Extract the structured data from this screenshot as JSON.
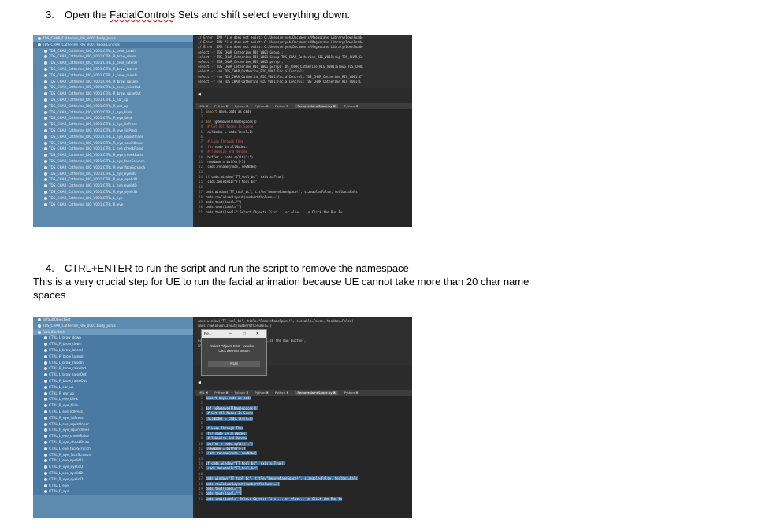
{
  "step3": {
    "number": "3.",
    "text_before": "Open the ",
    "text_squiggle": "FacialControls",
    "text_after": " Sets and shift select everything down."
  },
  "step4": {
    "number": "4.",
    "text": "CTRL+ENTER to run the script and run the script to remove the namespace",
    "note": "This is a very crucial step for UE to run the facial animation because UE cannot take more than 20 char name spaces"
  },
  "shot1": {
    "outliner_rows": [
      {
        "label": "TDS_CHAR_Catherine_RIG_V001:Body_joints",
        "type": "hdr"
      },
      {
        "label": "TDS_CHAR_Catherine_RIG_V001:FacialControls",
        "type": "sel"
      },
      {
        "label": "TDS_CHAR_Catherine_RIG_V001:CTRL_L_brow_down",
        "type": "row"
      },
      {
        "label": "TDS_CHAR_Catherine_RIG_V001:CTRL_R_brow_down",
        "type": "row"
      },
      {
        "label": "TDS_CHAR_Catherine_RIG_V001:CTRL_L_brow_lateral",
        "type": "row"
      },
      {
        "label": "TDS_CHAR_Catherine_RIG_V001:CTRL_R_brow_lateral",
        "type": "row"
      },
      {
        "label": "TDS_CHAR_Catherine_RIG_V001:CTRL_L_brow_raiseIn",
        "type": "row"
      },
      {
        "label": "TDS_CHAR_Catherine_RIG_V001:CTRL_R_brow_raiseIn",
        "type": "row"
      },
      {
        "label": "TDS_CHAR_Catherine_RIG_V001:CTRL_L_brow_raiseOut",
        "type": "row"
      },
      {
        "label": "TDS_CHAR_Catherine_RIG_V001:CTRL_R_brow_raiseOut",
        "type": "row"
      },
      {
        "label": "TDS_CHAR_Catherine_RIG_V001:CTRL_L_ear_up",
        "type": "row"
      },
      {
        "label": "TDS_CHAR_Catherine_RIG_V001:CTRL_R_ear_up",
        "type": "row"
      },
      {
        "label": "TDS_CHAR_Catherine_RIG_V001:CTRL_L_eye_blink",
        "type": "row"
      },
      {
        "label": "TDS_CHAR_Catherine_RIG_V001:CTRL_R_eye_blink",
        "type": "row"
      },
      {
        "label": "TDS_CHAR_Catherine_RIG_V001:CTRL_L_eye_lidPress",
        "type": "row"
      },
      {
        "label": "TDS_CHAR_Catherine_RIG_V001:CTRL_R_eye_lidPress",
        "type": "row"
      },
      {
        "label": "TDS_CHAR_Catherine_RIG_V001:CTRL_L_eye_squintInner",
        "type": "row"
      },
      {
        "label": "TDS_CHAR_Catherine_RIG_V001:CTRL_R_eye_squintInner",
        "type": "row"
      },
      {
        "label": "TDS_CHAR_Catherine_RIG_V001:CTRL_L_eye_cheekRaise",
        "type": "row"
      },
      {
        "label": "TDS_CHAR_Catherine_RIG_V001:CTRL_R_eye_cheekRaise",
        "type": "row"
      },
      {
        "label": "TDS_CHAR_Catherine_RIG_V001:CTRL_L_eye_faceScrunch",
        "type": "row"
      },
      {
        "label": "TDS_CHAR_Catherine_RIG_V001:CTRL_R_eye_faceScrunch",
        "type": "row"
      },
      {
        "label": "TDS_CHAR_Catherine_RIG_V001:CTRL_L_eye_eyelidU",
        "type": "row"
      },
      {
        "label": "TDS_CHAR_Catherine_RIG_V001:CTRL_R_eye_eyelidU",
        "type": "row"
      },
      {
        "label": "TDS_CHAR_Catherine_RIG_V001:CTRL_L_eye_eyelidD",
        "type": "row"
      },
      {
        "label": "TDS_CHAR_Catherine_RIG_V001:CTRL_R_eye_eyelidD",
        "type": "row"
      },
      {
        "label": "TDS_CHAR_Catherine_RIG_V001:CTRL_L_eye",
        "type": "row"
      },
      {
        "label": "TDS_CHAR_Catherine_RIG_V001:CTRL_R_eye",
        "type": "row"
      }
    ],
    "console_lines": [
      "// Error: IMA file does not exist: C:/Users/ntyoh/Documents/Megascans Library/Downloade",
      "// Error: IMA file does not exist: C:/Users/ntyoh/Documents/Megascans Library/Downloade",
      "// Error: IMA file does not exist: C:/Users/ntyoh/Documents/Megascans Library/Downloade",
      "select -r TDS_CHAR_Catherine_RIG_V001:Group ;",
      "select -r TDS_CHAR_Catherine_RIG_V001:Group TDS_CHAR_Catherine_RIG_V001:rig TDS_CHAR_Ca",
      "select -r TDS_CHAR_Catherine_RIG_V001:persp ;",
      "select -r TDS_CHAR_Catherine_RIG_V001:persp1 TDS_CHAR_Catherine_RIG_V001:Group TDS_CHAR",
      "select -r -ne TDS_CHAR_Catherine_RIG_V001:FacialControls ;",
      "select -r -ne TDS_CHAR_Catherine_RIG_V001:FacialControls TDS_CHAR_Catherine_RIG_V001:CT",
      "select -r -ne TDS_CHAR_Catherine_RIG_V001:FacialControls TDS_CHAR_Catherine_RIG_V001:CT"
    ],
    "tabs": [
      "MEL",
      "Python",
      "Python",
      "Python",
      "Python",
      "RemoveNameSpace.py",
      "Python"
    ],
    "code": [
      {
        "n": "1",
        "parts": [
          {
            "c": "kw",
            "t": "import"
          },
          {
            "c": "tx",
            "t": " maya.cmds as cmds"
          }
        ]
      },
      {
        "n": "2",
        "parts": []
      },
      {
        "n": "3",
        "parts": [
          {
            "c": "kw",
            "t": "def"
          },
          {
            "c": "tx",
            "t": " jgRemoveAllNamespaces():"
          }
        ]
      },
      {
        "n": "4",
        "parts": [
          {
            "c": "cm",
            "t": "    # Get All Nodes In Scene"
          }
        ]
      },
      {
        "n": "5",
        "parts": [
          {
            "c": "tx",
            "t": "    allNodes = cmds.ls(sl=1)"
          }
        ]
      },
      {
        "n": "6",
        "parts": []
      },
      {
        "n": "7",
        "parts": [
          {
            "c": "cm",
            "t": "    # Loop Through Them"
          }
        ]
      },
      {
        "n": "8",
        "parts": [
          {
            "c": "kw",
            "t": "    for"
          },
          {
            "c": "tx",
            "t": " node in allNodes:"
          }
        ]
      },
      {
        "n": "9",
        "parts": [
          {
            "c": "cm",
            "t": "        # Tokenize And Rename"
          }
        ]
      },
      {
        "n": "10",
        "parts": [
          {
            "c": "tx",
            "t": "        buffer = node.split(\":\")"
          }
        ]
      },
      {
        "n": "11",
        "parts": [
          {
            "c": "tx",
            "t": "        newName = buffer[-1]"
          }
        ]
      },
      {
        "n": "12",
        "parts": [
          {
            "c": "tx",
            "t": "        cmds.rename(node, newName)"
          }
        ]
      },
      {
        "n": "13",
        "parts": []
      },
      {
        "n": "14",
        "parts": [
          {
            "c": "kw",
            "t": "if"
          },
          {
            "c": "tx",
            "t": " cmds.window(\"TT_tool_bc\", exists=True):"
          }
        ]
      },
      {
        "n": "15",
        "parts": [
          {
            "c": "tx",
            "t": "    cmds.deleteUI(\"TT_tool_bc\")"
          }
        ]
      },
      {
        "n": "16",
        "parts": []
      },
      {
        "n": "17",
        "parts": [
          {
            "c": "tx",
            "t": "cmds.window(\"TT_tool_bc\", title=\"RemoveNameSpace!\", sizeable=False, toolbox=Fals"
          }
        ]
      },
      {
        "n": "18",
        "parts": [
          {
            "c": "tx",
            "t": "cmds.rowColumnLayout(numberOfColumns=1)"
          }
        ]
      },
      {
        "n": "19",
        "parts": [
          {
            "c": "tx",
            "t": "cmds.text(label=\"\")"
          }
        ]
      },
      {
        "n": "20",
        "parts": [
          {
            "c": "tx",
            "t": "cmds.text(label=\"\")"
          }
        ]
      },
      {
        "n": "21",
        "parts": [
          {
            "c": "tx",
            "t": "cmds.text(label=\"                    Select Objects First....or else...  \\n Click the Run Bu"
          }
        ]
      }
    ]
  },
  "shot2": {
    "outliner_rows": [
      {
        "label": "defaultObjectSet",
        "type": "row"
      },
      {
        "label": "TDS_CHAR_Catherine_RIG_V001:Body_joints",
        "type": "row"
      },
      {
        "label": "FacialControls",
        "type": "hdr"
      },
      {
        "label": "CTRL_L_brow_down",
        "type": "sel"
      },
      {
        "label": "CTRL_R_brow_down",
        "type": "sel"
      },
      {
        "label": "CTRL_L_brow_lateral",
        "type": "sel"
      },
      {
        "label": "CTRL_R_brow_lateral",
        "type": "sel"
      },
      {
        "label": "CTRL_L_brow_raiseIn",
        "type": "sel"
      },
      {
        "label": "CTRL_R_brow_raiseInd",
        "type": "sel"
      },
      {
        "label": "CTRL_L_brow_raiseOut",
        "type": "sel"
      },
      {
        "label": "CTRL_R_brow_raiseOut",
        "type": "sel"
      },
      {
        "label": "CTRL_L_ear_up",
        "type": "sel"
      },
      {
        "label": "CTRL_R_ear_up",
        "type": "sel"
      },
      {
        "label": "CTRL_L_eye_blink",
        "type": "sel"
      },
      {
        "label": "CTRL_R_eye_blink",
        "type": "sel"
      },
      {
        "label": "CTRL_L_eye_lidPress",
        "type": "sel"
      },
      {
        "label": "CTRL_R_eye_lidPress",
        "type": "sel"
      },
      {
        "label": "CTRL_L_eye_squintInner",
        "type": "sel"
      },
      {
        "label": "CTRL_R_eye_squintInner",
        "type": "sel"
      },
      {
        "label": "CTRL_L_eye_cheekRaise",
        "type": "sel"
      },
      {
        "label": "CTRL_R_eye_cheekRaise",
        "type": "sel"
      },
      {
        "label": "CTRL_L_eye_faceScrunch",
        "type": "sel"
      },
      {
        "label": "CTRL_R_eye_faceScrunch",
        "type": "sel"
      },
      {
        "label": "CTRL_L_eye_eyelidU",
        "type": "sel"
      },
      {
        "label": "CTRL_R_eye_eyelidU",
        "type": "sel"
      },
      {
        "label": "CTRL_L_eye_eyelidD",
        "type": "sel"
      },
      {
        "label": "CTRL_R_eye_eyelidD",
        "type": "sel"
      },
      {
        "label": "CTRL_L_eye",
        "type": "sel"
      },
      {
        "label": "CTRL_R_eye",
        "type": "sel"
      }
    ],
    "console_lines": [
      "cmds.window(\"TT_tool_bc\", title=\"RemoveNameSpace!\", sizeable=False, toolbox=False)",
      "cmds.rowColumnLayout(numberOfColumns=1)",
      "",
      "",
      "                          ect Objects First....or else...  \\n Click the Run Button\",",
      "                          and=\"jgRemoveAllNamespaces()\")"
    ],
    "popup": {
      "title": "Re...",
      "controls": "— □ ✕",
      "message_1": "Select Objects First....or else....",
      "message_2": "Click the Run Button",
      "run_label": "RUN"
    },
    "tabs": [
      "MEL",
      "Python",
      "Python",
      "Python",
      "Python",
      "RemoveNameSpace.py",
      "Python"
    ],
    "code": [
      {
        "n": "1",
        "parts": [
          {
            "c": "kw hl",
            "t": "import"
          },
          {
            "c": "tx hl",
            "t": " maya.cmds as cmds"
          }
        ]
      },
      {
        "n": "2",
        "parts": []
      },
      {
        "n": "3",
        "parts": [
          {
            "c": "kw hl",
            "t": "def"
          },
          {
            "c": "tx hl",
            "t": " jgRemoveAllNamespaces():"
          }
        ]
      },
      {
        "n": "4",
        "parts": [
          {
            "c": "tx hl",
            "t": "    # Get All Nodes In Scene"
          }
        ]
      },
      {
        "n": "5",
        "parts": [
          {
            "c": "tx hl",
            "t": "    allNodes = cmds.ls(sl=1)"
          }
        ]
      },
      {
        "n": "6",
        "parts": []
      },
      {
        "n": "7",
        "parts": [
          {
            "c": "tx hl",
            "t": "    # Loop Through Them"
          }
        ]
      },
      {
        "n": "8",
        "parts": [
          {
            "c": "tx hl",
            "t": "    for node in allNodes:"
          }
        ]
      },
      {
        "n": "9",
        "parts": [
          {
            "c": "tx hl",
            "t": "        # Tokenize And Rename"
          }
        ]
      },
      {
        "n": "10",
        "parts": [
          {
            "c": "tx hl",
            "t": "        buffer = node.split(\":\")"
          }
        ]
      },
      {
        "n": "11",
        "parts": [
          {
            "c": "tx hl",
            "t": "        newName = buffer[-1]"
          }
        ]
      },
      {
        "n": "12",
        "parts": [
          {
            "c": "tx hl",
            "t": "        cmds.rename(node, newName)"
          }
        ]
      },
      {
        "n": "13",
        "parts": []
      },
      {
        "n": "14",
        "parts": [
          {
            "c": "tx hl",
            "t": "if cmds.window(\"TT_tool_bc\", exists=True):"
          }
        ]
      },
      {
        "n": "15",
        "parts": [
          {
            "c": "tx hl",
            "t": "    cmds.deleteUI(\"TT_tool_bc\")"
          }
        ]
      },
      {
        "n": "16",
        "parts": []
      },
      {
        "n": "17",
        "parts": [
          {
            "c": "tx hl",
            "t": "cmds.window(\"TT_tool_bc\", title=\"RemoveNameSpace!\", sizeable=False, toolbox=Fals"
          }
        ]
      },
      {
        "n": "18",
        "parts": [
          {
            "c": "tx hl",
            "t": "cmds.rowColumnLayout(numberOfColumns=1)"
          }
        ]
      },
      {
        "n": "19",
        "parts": [
          {
            "c": "tx hl",
            "t": "cmds.text(label=\"\")"
          }
        ]
      },
      {
        "n": "20",
        "parts": [
          {
            "c": "tx hl",
            "t": "cmds.text(label=\"\")"
          }
        ]
      },
      {
        "n": "21",
        "parts": [
          {
            "c": "tx hl",
            "t": "cmds.text(label=\"                    Select Objects First....or else...  \\n Click the Run Bu"
          }
        ]
      }
    ]
  },
  "icons": {
    "outliner_node": "circle-node-icon",
    "nav_arrow": "left-arrow-icon"
  },
  "colors": {
    "outliner_bg": "#5d8bb0",
    "editor_bg": "#262626",
    "selection": "#3e6f9e"
  }
}
